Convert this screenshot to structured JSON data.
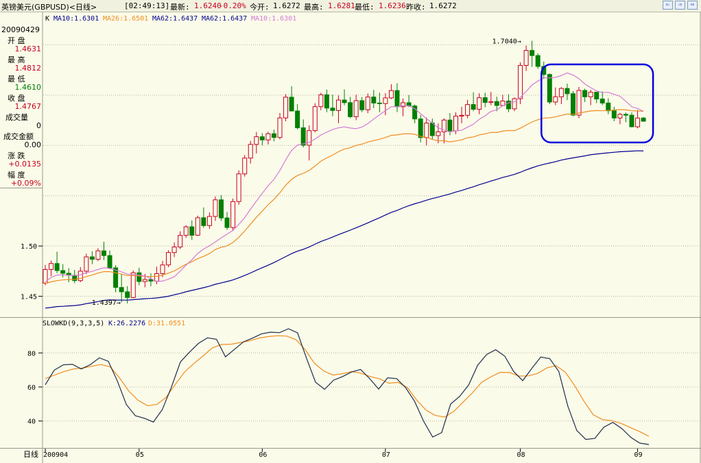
{
  "header": {
    "symbol": "英镑美元(GBPUSD)<日线>",
    "time": "[02:49:13]",
    "latest_label": "最新:",
    "latest_value": "1.6240",
    "change": "-0.20%",
    "open_label": "今开:",
    "open_value": "1.6272",
    "high_label": "最高:",
    "high_value": "1.6281",
    "low_label": "最低:",
    "low_value": "1.6236",
    "prev_label": "昨收:",
    "prev_value": "1.6272",
    "nav_buttons": [
      "⇐",
      "⇒",
      "⇔"
    ]
  },
  "info_panel": {
    "date": "20090429",
    "rows": [
      {
        "label": "开  盘",
        "value": "1.4631",
        "color": "#c8001e"
      },
      {
        "label": "最  高",
        "value": "1.4812",
        "color": "#c8001e"
      },
      {
        "label": "最  低",
        "value": "1.4610",
        "color": "#008000"
      },
      {
        "label": "收  盘",
        "value": "1.4767",
        "color": "#c8001e"
      },
      {
        "label": "成交量",
        "value": "0",
        "color": "#000000"
      },
      {
        "label": "成交金额",
        "value": "0.00",
        "color": "#000000"
      },
      {
        "label": "涨  跌",
        "value": "+0.0135",
        "color": "#c8001e"
      },
      {
        "label": "幅  度",
        "value": "+0.09%",
        "color": "#c8001e"
      }
    ]
  },
  "colors": {
    "up": "#c8001e",
    "down": "#008000",
    "ma10": "#d27ad8",
    "ma26": "#f08c1e",
    "ma62": "#000090",
    "k": "#1e2d4b",
    "d": "#f08c1e",
    "highlight": "#0000e0"
  },
  "chart_data": [
    {
      "type": "candlestick",
      "legend": {
        "k_label": "K",
        "ma10": "MA10:1.6301",
        "ma26": "MA26:1.6501",
        "ma62a": "MA62:1.6437",
        "ma62b": "MA62:1.6437",
        "ma10b": "MA10:1.6301"
      },
      "ylim": [
        1.43,
        1.72
      ],
      "yticks": [
        "1.50",
        "1.45"
      ],
      "annotations": {
        "high": "1.7040",
        "low": "1.4397"
      },
      "candles": [
        [
          1.4631,
          1.4812,
          1.461,
          1.4767
        ],
        [
          1.4767,
          1.4855,
          1.47,
          1.4826
        ],
        [
          1.4826,
          1.4944,
          1.473,
          1.4756
        ],
        [
          1.4756,
          1.482,
          1.469,
          1.4729
        ],
        [
          1.4729,
          1.478,
          1.464,
          1.4709
        ],
        [
          1.4709,
          1.4763,
          1.463,
          1.4656
        ],
        [
          1.4656,
          1.479,
          1.464,
          1.475
        ],
        [
          1.475,
          1.4924,
          1.472,
          1.4892
        ],
        [
          1.4892,
          1.4948,
          1.482,
          1.4868
        ],
        [
          1.4868,
          1.4978,
          1.485,
          1.4952
        ],
        [
          1.4952,
          1.5042,
          1.486,
          1.4905
        ],
        [
          1.4905,
          1.4955,
          1.477,
          1.4783
        ],
        [
          1.4783,
          1.481,
          1.454,
          1.4588
        ],
        [
          1.4588,
          1.4718,
          1.444,
          1.4545
        ],
        [
          1.4545,
          1.4601,
          1.443,
          1.4488
        ],
        [
          1.4488,
          1.4756,
          1.448,
          1.4734
        ],
        [
          1.4734,
          1.4784,
          1.461,
          1.4647
        ],
        [
          1.4647,
          1.4723,
          1.459,
          1.4667
        ],
        [
          1.4667,
          1.473,
          1.46,
          1.4651
        ],
        [
          1.4651,
          1.4795,
          1.462,
          1.4726
        ],
        [
          1.4726,
          1.4852,
          1.469,
          1.4812
        ],
        [
          1.4812,
          1.4958,
          1.479,
          1.4935
        ],
        [
          1.4935,
          1.5035,
          1.489,
          1.499
        ],
        [
          1.499,
          1.5146,
          1.497,
          1.5106
        ],
        [
          1.5106,
          1.5206,
          1.508,
          1.5191
        ],
        [
          1.5191,
          1.5255,
          1.506,
          1.5107
        ],
        [
          1.5107,
          1.5301,
          1.51,
          1.5281
        ],
        [
          1.5281,
          1.5383,
          1.518,
          1.5203
        ],
        [
          1.5203,
          1.5334,
          1.517,
          1.5294
        ],
        [
          1.5294,
          1.5493,
          1.525,
          1.5459
        ],
        [
          1.5459,
          1.5506,
          1.525,
          1.5279
        ],
        [
          1.5279,
          1.5339,
          1.516,
          1.5184
        ],
        [
          1.5184,
          1.5472,
          1.515,
          1.5442
        ],
        [
          1.5442,
          1.5752,
          1.541,
          1.5717
        ],
        [
          1.5717,
          1.5904,
          1.569,
          1.5874
        ],
        [
          1.5874,
          1.6045,
          1.582,
          1.601
        ],
        [
          1.601,
          1.6133,
          1.592,
          1.6086
        ],
        [
          1.6086,
          1.6121,
          1.6,
          1.6054
        ],
        [
          1.6054,
          1.6136,
          1.601,
          1.6116
        ],
        [
          1.6116,
          1.6156,
          1.604,
          1.6079
        ],
        [
          1.6079,
          1.6322,
          1.606,
          1.6273
        ],
        [
          1.6273,
          1.6509,
          1.624,
          1.6479
        ],
        [
          1.6479,
          1.6588,
          1.634,
          1.6342
        ],
        [
          1.6342,
          1.641,
          1.616,
          1.6175
        ],
        [
          1.6175,
          1.6258,
          1.598,
          1.6002
        ],
        [
          1.6002,
          1.6198,
          1.585,
          1.6147
        ],
        [
          1.6147,
          1.6419,
          1.613,
          1.6385
        ],
        [
          1.6385,
          1.6523,
          1.635,
          1.6503
        ],
        [
          1.6503,
          1.6554,
          1.633,
          1.6371
        ],
        [
          1.6371,
          1.6505,
          1.629,
          1.6347
        ],
        [
          1.6347,
          1.6497,
          1.622,
          1.6451
        ],
        [
          1.6451,
          1.6557,
          1.64,
          1.6425
        ],
        [
          1.6425,
          1.6482,
          1.627,
          1.6285
        ],
        [
          1.6285,
          1.6503,
          1.625,
          1.6445
        ],
        [
          1.6445,
          1.6481,
          1.633,
          1.6354
        ],
        [
          1.6354,
          1.6515,
          1.632,
          1.6481
        ],
        [
          1.6481,
          1.6552,
          1.637,
          1.6421
        ],
        [
          1.6421,
          1.6525,
          1.633,
          1.6416
        ],
        [
          1.6416,
          1.6519,
          1.63,
          1.6472
        ],
        [
          1.6472,
          1.6608,
          1.646,
          1.6545
        ],
        [
          1.6545,
          1.6618,
          1.633,
          1.6384
        ],
        [
          1.6384,
          1.6466,
          1.629,
          1.6424
        ],
        [
          1.6424,
          1.6501,
          1.638,
          1.6392
        ],
        [
          1.6392,
          1.6407,
          1.622,
          1.6263
        ],
        [
          1.6263,
          1.6302,
          1.603,
          1.6078
        ],
        [
          1.6078,
          1.6278,
          1.6,
          1.6222
        ],
        [
          1.6222,
          1.6267,
          1.606,
          1.6097
        ],
        [
          1.6097,
          1.6218,
          1.602,
          1.6135
        ],
        [
          1.6135,
          1.6269,
          1.602,
          1.6252
        ],
        [
          1.6252,
          1.6321,
          1.61,
          1.6145
        ],
        [
          1.6145,
          1.6329,
          1.611,
          1.6291
        ],
        [
          1.6291,
          1.6384,
          1.622,
          1.6299
        ],
        [
          1.6299,
          1.6453,
          1.627,
          1.6406
        ],
        [
          1.6406,
          1.6528,
          1.634,
          1.6359
        ],
        [
          1.6359,
          1.6518,
          1.631,
          1.6474
        ],
        [
          1.6474,
          1.6524,
          1.638,
          1.6427
        ],
        [
          1.6427,
          1.6532,
          1.64,
          1.6436
        ],
        [
          1.6436,
          1.6484,
          1.634,
          1.6397
        ],
        [
          1.6397,
          1.6503,
          1.639,
          1.6441
        ],
        [
          1.6441,
          1.6509,
          1.633,
          1.6363
        ],
        [
          1.6363,
          1.6477,
          1.634,
          1.6464
        ],
        [
          1.6464,
          1.6826,
          1.641,
          1.6795
        ],
        [
          1.6795,
          1.6992,
          1.674,
          1.6944
        ],
        [
          1.6944,
          1.704,
          1.678,
          1.6893
        ],
        [
          1.6893,
          1.6915,
          1.676,
          1.6785
        ],
        [
          1.6785,
          1.6833,
          1.666,
          1.6705
        ],
        [
          1.6705,
          1.6715,
          1.641,
          1.6431
        ],
        [
          1.6431,
          1.6576,
          1.64,
          1.6483
        ],
        [
          1.6483,
          1.6579,
          1.641,
          1.6566
        ],
        [
          1.6566,
          1.6614,
          1.645,
          1.6514
        ],
        [
          1.6514,
          1.654,
          1.629,
          1.6301
        ],
        [
          1.6301,
          1.6581,
          1.627,
          1.6546
        ],
        [
          1.6546,
          1.6564,
          1.643,
          1.6483
        ],
        [
          1.6483,
          1.6552,
          1.64,
          1.6529
        ],
        [
          1.6529,
          1.6528,
          1.642,
          1.6461
        ],
        [
          1.6461,
          1.6537,
          1.64,
          1.6421
        ],
        [
          1.6421,
          1.6469,
          1.631,
          1.6344
        ],
        [
          1.6344,
          1.6383,
          1.624,
          1.6272
        ],
        [
          1.6272,
          1.6324,
          1.621,
          1.6309
        ],
        [
          1.6309,
          1.6326,
          1.623,
          1.63
        ],
        [
          1.63,
          1.6328,
          1.618,
          1.6185
        ],
        [
          1.6185,
          1.6352,
          1.617,
          1.6272
        ],
        [
          1.6272,
          1.6281,
          1.6236,
          1.624
        ]
      ],
      "ma10": [
        1.4642,
        1.4688,
        1.4711,
        1.4714,
        1.4709,
        1.4705,
        1.4713,
        1.4735,
        1.4748,
        1.4767,
        1.4783,
        1.4778,
        1.4761,
        1.4743,
        1.4721,
        1.4715,
        1.4709,
        1.4703,
        1.4676,
        1.4648,
        1.4651,
        1.467,
        1.4694,
        1.4749,
        1.481,
        1.4864,
        1.4926,
        1.497,
        1.5002,
        1.504,
        1.508,
        1.5118,
        1.5155,
        1.5215,
        1.5281,
        1.5366,
        1.5446,
        1.5524,
        1.5599,
        1.5663,
        1.5751,
        1.5857,
        1.5951,
        1.6003,
        1.6016,
        1.6029,
        1.6064,
        1.6104,
        1.6131,
        1.6158,
        1.6175,
        1.6184,
        1.6173,
        1.6166,
        1.6182,
        1.6216,
        1.6262,
        1.6305,
        1.6345,
        1.6385,
        1.6385,
        1.6394,
        1.6394,
        1.6365,
        1.6315,
        1.6266,
        1.6222,
        1.6175,
        1.6153,
        1.6132,
        1.6145,
        1.615,
        1.6181,
        1.6211,
        1.626,
        1.6294,
        1.6338,
        1.6354,
        1.6393,
        1.6423,
        1.6432,
        1.6478,
        1.6536,
        1.6601,
        1.664,
        1.6671,
        1.6671,
        1.6676,
        1.6694,
        1.6721,
        1.6699,
        1.6663,
        1.6611,
        1.6574,
        1.6542,
        1.6525,
        1.6528,
        1.6508,
        1.6488,
        1.6437,
        1.6384,
        1.6367,
        1.6339
      ],
      "ma26": [
        1.4627,
        1.4644,
        1.4656,
        1.4663,
        1.4667,
        1.4668,
        1.4677,
        1.4696,
        1.4711,
        1.4731,
        1.4745,
        1.4745,
        1.4733,
        1.4721,
        1.4706,
        1.4707,
        1.4702,
        1.4699,
        1.4696,
        1.4699,
        1.471,
        1.473,
        1.4753,
        1.4785,
        1.4819,
        1.4844,
        1.4874,
        1.4897,
        1.4925,
        1.4965,
        1.4988,
        1.5002,
        1.5035,
        1.5087,
        1.5148,
        1.5217,
        1.5285,
        1.5347,
        1.541,
        1.5465,
        1.5529,
        1.5605,
        1.5662,
        1.5701,
        1.5723,
        1.5751,
        1.5795,
        1.5844,
        1.5876,
        1.5904,
        1.5937,
        1.5964,
        1.5977,
        1.6,
        1.6013,
        1.6034,
        1.6048,
        1.6061,
        1.6078,
        1.61,
        1.6105,
        1.6114,
        1.6116,
        1.611,
        1.6089,
        1.608,
        1.6059,
        1.6044,
        1.6047,
        1.6035,
        1.6044,
        1.6055,
        1.6076,
        1.6083,
        1.6105,
        1.6115,
        1.613,
        1.6128,
        1.6142,
        1.6148,
        1.6146,
        1.6171,
        1.6202,
        1.6233,
        1.6255,
        1.6272,
        1.6274,
        1.6283,
        1.6299,
        1.6312,
        1.6307,
        1.6322,
        1.6332,
        1.6342,
        1.6346,
        1.6344,
        1.6348,
        1.6352,
        1.6356,
        1.6353,
        1.6344,
        1.6342,
        1.6339
      ],
      "ma62": [
        1.4383,
        1.4389,
        1.4398,
        1.4401,
        1.4405,
        1.4408,
        1.4415,
        1.4427,
        1.4436,
        1.4448,
        1.4459,
        1.4464,
        1.4463,
        1.4462,
        1.4462,
        1.4467,
        1.4471,
        1.4476,
        1.4479,
        1.4484,
        1.4491,
        1.4501,
        1.4515,
        1.4529,
        1.4545,
        1.4559,
        1.4572,
        1.4586,
        1.4601,
        1.462,
        1.4633,
        1.4647,
        1.4663,
        1.4684,
        1.4707,
        1.4732,
        1.4759,
        1.4785,
        1.4809,
        1.4836,
        1.4865,
        1.4895,
        1.4924,
        1.4949,
        1.4967,
        1.499,
        1.5018,
        1.5045,
        1.5066,
        1.5089,
        1.5113,
        1.5135,
        1.5158,
        1.5181,
        1.5205,
        1.523,
        1.5256,
        1.5281,
        1.5308,
        1.5334,
        1.5354,
        1.5379,
        1.5401,
        1.542,
        1.5436,
        1.5455,
        1.5472,
        1.5486,
        1.5502,
        1.5517,
        1.5536,
        1.5552,
        1.5571,
        1.5589,
        1.5609,
        1.5627,
        1.5646,
        1.5663,
        1.5681,
        1.5696,
        1.5712,
        1.5733,
        1.5756,
        1.5777,
        1.5796,
        1.5812,
        1.5825,
        1.5838,
        1.5854,
        1.5866,
        1.5876,
        1.5886,
        1.5896,
        1.5907,
        1.5914,
        1.592,
        1.5926,
        1.5932,
        1.5937,
        1.594,
        1.5943,
        1.5946,
        1.5945
      ],
      "x_ticks": [
        {
          "label": "200904",
          "index": 0
        },
        {
          "label": "05",
          "index": 16
        },
        {
          "label": "06",
          "index": 37
        },
        {
          "label": "07",
          "index": 58
        },
        {
          "label": "08",
          "index": 81
        },
        {
          "label": "09",
          "index": 101
        }
      ]
    },
    {
      "type": "line",
      "legend": {
        "name": "SLOWKD(9,3,3,5)",
        "k": "K:26.2276",
        "d": "D:31.0551"
      },
      "ylim": [
        25,
        95
      ],
      "yticks": [
        "80",
        "60",
        "40"
      ],
      "x_label": "日线",
      "k": [
        61.3,
        69.9,
        73.0,
        73.3,
        70.6,
        73.1,
        77.1,
        75.1,
        63.5,
        49.7,
        43.1,
        41.6,
        39.4,
        46.8,
        59.9,
        74.7,
        80.4,
        85.6,
        88.9,
        88.0,
        77.7,
        82.1,
        86.5,
        88.7,
        91.2,
        92.2,
        91.9,
        94.2,
        91.8,
        76.8,
        62.8,
        58.6,
        64.0,
        66.1,
        68.8,
        70.3,
        65.0,
        58.8,
        65.4,
        64.9,
        59.6,
        51.5,
        39.9,
        30.6,
        33.2,
        50.0,
        54.5,
        61.2,
        72.8,
        79.1,
        81.9,
        78.1,
        69.0,
        63.7,
        70.9,
        77.6,
        76.6,
        69.1,
        48.8,
        34.4,
        29.2,
        29.8,
        36.4,
        39.2,
        35.6,
        30.4,
        27.0,
        26.2
      ],
      "d": [
        64.9,
        67.0,
        69.0,
        70.5,
        71.1,
        72.2,
        73.2,
        71.8,
        65.3,
        57.6,
        52.2,
        49.0,
        49.7,
        53.8,
        61.5,
        68.8,
        73.8,
        78.3,
        83.0,
        85.0,
        85.1,
        86.1,
        87.1,
        88.7,
        89.6,
        90.1,
        89.9,
        87.8,
        81.8,
        73.8,
        69.3,
        67.0,
        67.8,
        69.0,
        68.1,
        66.1,
        64.8,
        62.2,
        62.7,
        59.6,
        52.3,
        46.4,
        43.3,
        42.3,
        45.7,
        51.1,
        56.6,
        62.8,
        66.0,
        68.6,
        68.5,
        66.4,
        66.5,
        67.9,
        71.2,
        72.5,
        68.7,
        60.9,
        51.7,
        43.7,
        40.8,
        40.2,
        38.6,
        36.2,
        33.8,
        31.0
      ]
    }
  ]
}
